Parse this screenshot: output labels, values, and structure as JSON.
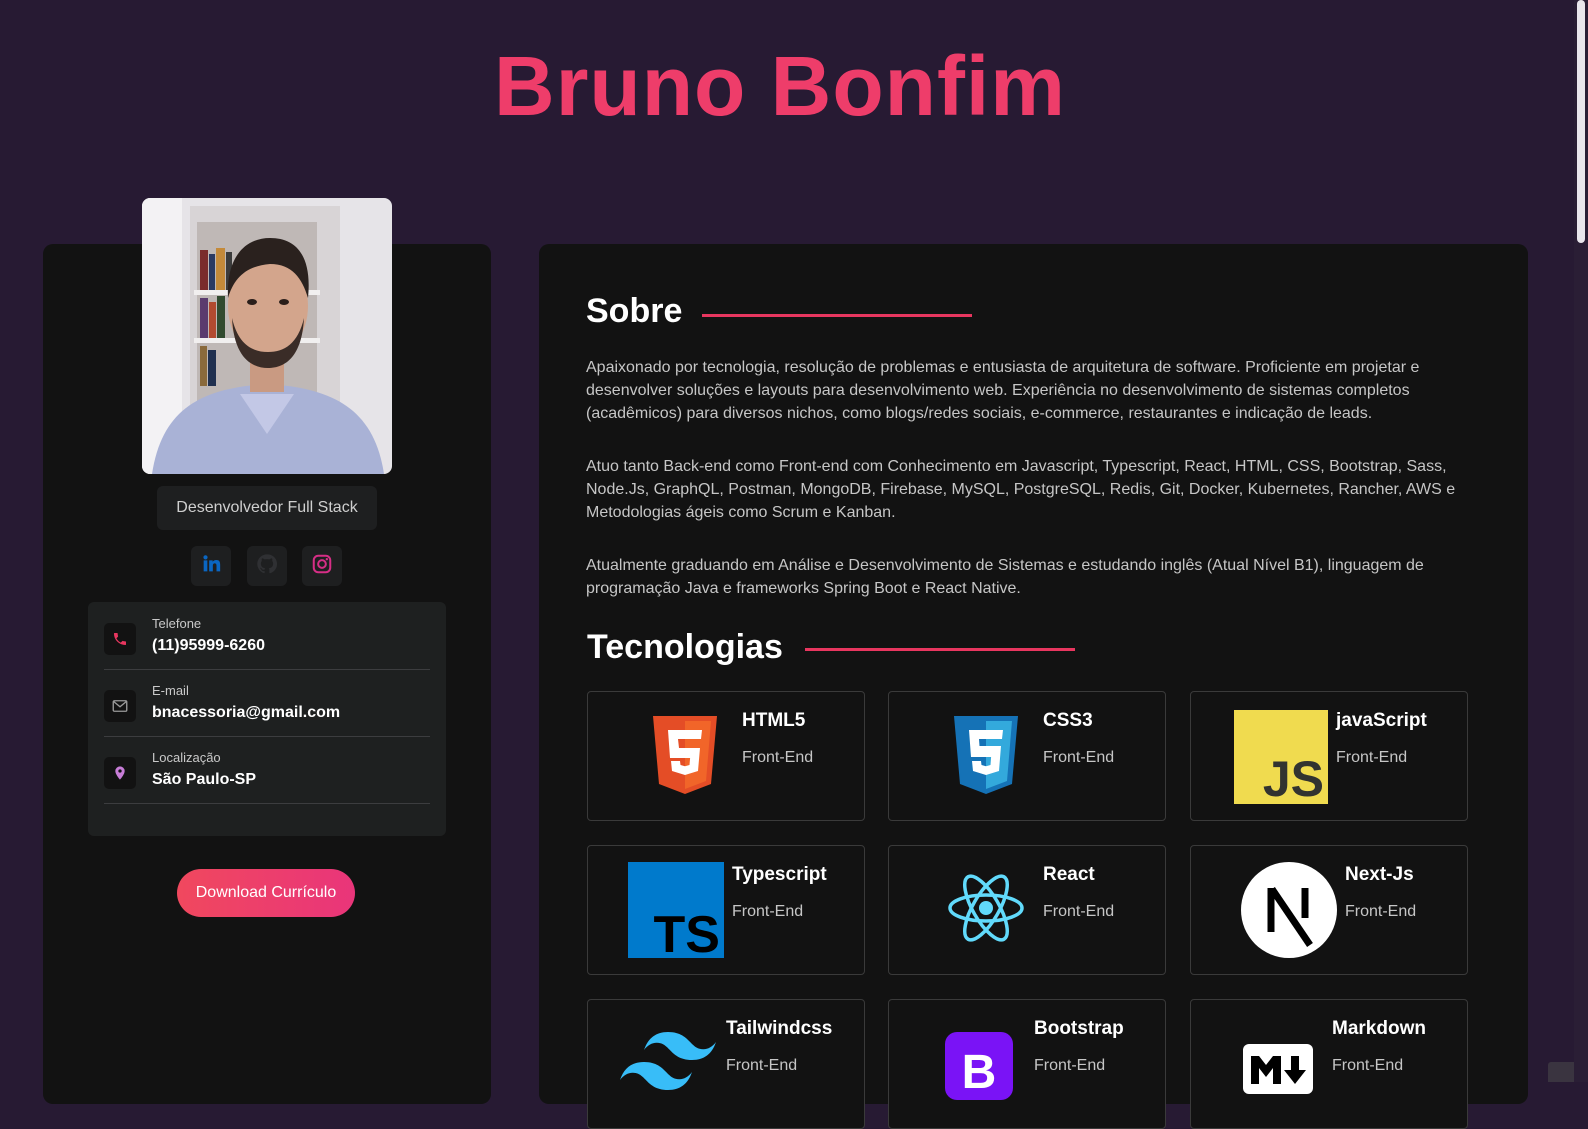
{
  "header": {
    "name": "Bruno Bonfim"
  },
  "profile": {
    "photo_alt": "",
    "role": "Desenvolvedor Full Stack",
    "social": [
      "linkedin-icon",
      "github-icon",
      "instagram-icon"
    ],
    "contacts": [
      {
        "icon": "phone-icon",
        "label": "Telefone",
        "value": "(11)95999-6260"
      },
      {
        "icon": "mail-icon",
        "label": "E-mail",
        "value": "bnacessoria@gmail.com"
      },
      {
        "icon": "location-pin-icon",
        "label": "Localização",
        "value": "São Paulo-SP"
      }
    ],
    "download_label": "Download Currículo"
  },
  "about": {
    "title": "Sobre",
    "paragraphs": [
      "Apaixonado por tecnologia, resolução de problemas e entusiasta de arquitetura de software. Proficiente em projetar e desenvolver soluções e layouts para desenvolvimento web. Experiência no desenvolvimento de sistemas completos (acadêmicos) para diversos nichos, como blogs/redes sociais, e-commerce, restaurantes e indicação de leads.",
      "Atuo tanto Back-end como Front-end com Conhecimento em Javascript, Typescript, React, HTML, CSS, Bootstrap, Sass, Node.Js, GraphQL, Postman, MongoDB, Firebase, MySQL, PostgreSQL, Redis, Git, Docker, Kubernetes, Rancher, AWS e Metodologias ágeis como Scrum e Kanban.",
      "Atualmente graduando em Análise e Desenvolvimento de Sistemas e estudando inglês (Atual Nível B1), linguagem de programação Java e frameworks Spring Boot e React Native."
    ]
  },
  "technologies": {
    "title": "Tecnologias",
    "items": [
      {
        "name": "HTML5",
        "category": "Front-End",
        "icon": "html5-icon"
      },
      {
        "name": "CSS3",
        "category": "Front-End",
        "icon": "css3-icon"
      },
      {
        "name": "javaScript",
        "category": "Front-End",
        "icon": "javascript-icon"
      },
      {
        "name": "Typescript",
        "category": "Front-End",
        "icon": "typescript-icon"
      },
      {
        "name": "React",
        "category": "Front-End",
        "icon": "react-icon"
      },
      {
        "name": "Next-Js",
        "category": "Front-End",
        "icon": "nextjs-icon"
      },
      {
        "name": "Tailwindcss",
        "category": "Front-End",
        "icon": "tailwind-icon"
      },
      {
        "name": "Bootstrap",
        "category": "Front-End",
        "icon": "bootstrap-icon"
      },
      {
        "name": "Markdown",
        "category": "Front-End",
        "icon": "markdown-icon"
      }
    ]
  },
  "colors": {
    "background": "#271a33",
    "accent": "#ee3d6a",
    "card": "#121212"
  }
}
